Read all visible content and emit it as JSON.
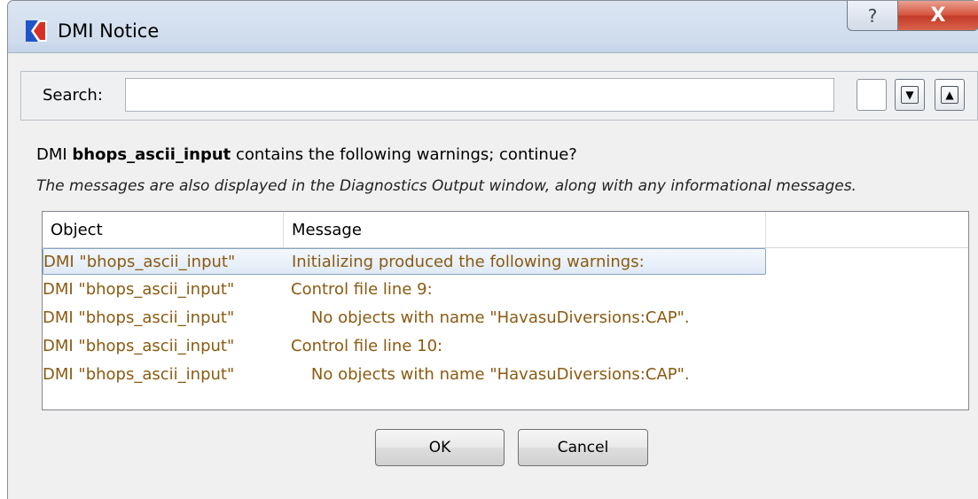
{
  "window": {
    "title": "DMI Notice",
    "help_glyph": "?",
    "close_glyph": "X"
  },
  "search": {
    "label": "Search:",
    "value": "",
    "placeholder": "",
    "find_next_glyph": "▼",
    "find_prev_glyph": "▲"
  },
  "prompt": {
    "prefix": "DMI ",
    "dmi_name": "bhops_ascii_input",
    "suffix": " contains the following warnings; continue?"
  },
  "note": "The messages are also displayed in the Diagnostics Output window, along with any informational messages.",
  "table": {
    "columns": [
      "Object",
      "Message",
      ""
    ],
    "rows": [
      {
        "object": "DMI \"bhops_ascii_input\"",
        "message": "Initializing produced the following warnings:",
        "selected": true
      },
      {
        "object": "DMI \"bhops_ascii_input\"",
        "message": "Control file line 9:",
        "selected": false
      },
      {
        "object": "DMI \"bhops_ascii_input\"",
        "message": "    No objects with name \"HavasuDiversions:CAP\".",
        "selected": false
      },
      {
        "object": "DMI \"bhops_ascii_input\"",
        "message": "Control file line 10:",
        "selected": false
      },
      {
        "object": "DMI \"bhops_ascii_input\"",
        "message": "    No objects with name \"HavasuDiversions:CAP\".",
        "selected": false
      }
    ],
    "row_text_color": "#8b5a10"
  },
  "buttons": {
    "ok": "OK",
    "cancel": "Cancel"
  },
  "colors": {
    "accent_close": "#c23a26",
    "selection_border": "#89a4c6"
  },
  "icons": {
    "app": "riverware-logo-icon",
    "help": "help-icon",
    "close": "close-icon",
    "down": "arrow-down-icon",
    "up": "arrow-up-icon"
  }
}
